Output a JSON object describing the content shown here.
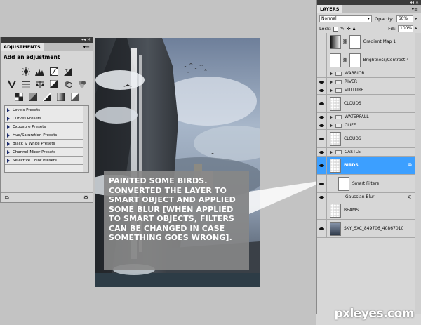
{
  "adjustments": {
    "tab_label": "ADJUSTMENTS",
    "heading": "Add an adjustment",
    "presets": [
      "Levels Presets",
      "Curves Presets",
      "Exposure Presets",
      "Hue/Saturation Presets",
      "Black & White Presets",
      "Channel Mixer Presets",
      "Selective Color Presets"
    ]
  },
  "layers_panel": {
    "tab_label": "LAYERS",
    "blend_mode": "Normal",
    "opacity_label": "Opacity:",
    "opacity_value": "60%",
    "lock_label": "Lock:",
    "fill_label": "Fill:",
    "fill_value": "100%",
    "layers": [
      {
        "name": "Gradient Map 1",
        "kind": "adjustment",
        "visible": false
      },
      {
        "name": "Brightness/Contrast 4",
        "kind": "adjustment",
        "visible": false
      },
      {
        "name": "WARRIOR",
        "kind": "group",
        "visible": false
      },
      {
        "name": "RIVER",
        "kind": "group",
        "visible": true
      },
      {
        "name": "VULTURE",
        "kind": "group",
        "visible": true
      },
      {
        "name": "CLOUDS",
        "kind": "pixel",
        "visible": true
      },
      {
        "name": "WATERFALL",
        "kind": "group",
        "visible": true
      },
      {
        "name": "CLIFF",
        "kind": "group",
        "visible": true
      },
      {
        "name": "CLOUDS",
        "kind": "pixel",
        "visible": true
      },
      {
        "name": "CASTLE",
        "kind": "group",
        "visible": true
      },
      {
        "name": "BIRDS",
        "kind": "smart-object",
        "visible": true,
        "selected": true
      },
      {
        "name": "Smart Filters",
        "kind": "smart-filters",
        "visible": true
      },
      {
        "name": "Gaussian Blur",
        "kind": "filter",
        "visible": true
      },
      {
        "name": "BEAMS",
        "kind": "pixel",
        "visible": false
      },
      {
        "name": "SKY_SXC_849706_40867010",
        "kind": "photo",
        "visible": true
      }
    ]
  },
  "annotation": {
    "text": "PAINTED SOME BIRDS. CONVERTED THE LAYER TO SMART OBJECT AND APPLIED SOME BLUR [WHEN APPLIED TO SMART OBJECTS, FILTERS CAN BE CHANGED IN CASE SOMETHING GOES WRONG]."
  },
  "watermark": "pxleyes.com",
  "colors": {
    "workspace": "#c3c3c3",
    "panel": "#d7d7d7",
    "selected_layer": "#3c9fff",
    "callout": "#878787"
  }
}
